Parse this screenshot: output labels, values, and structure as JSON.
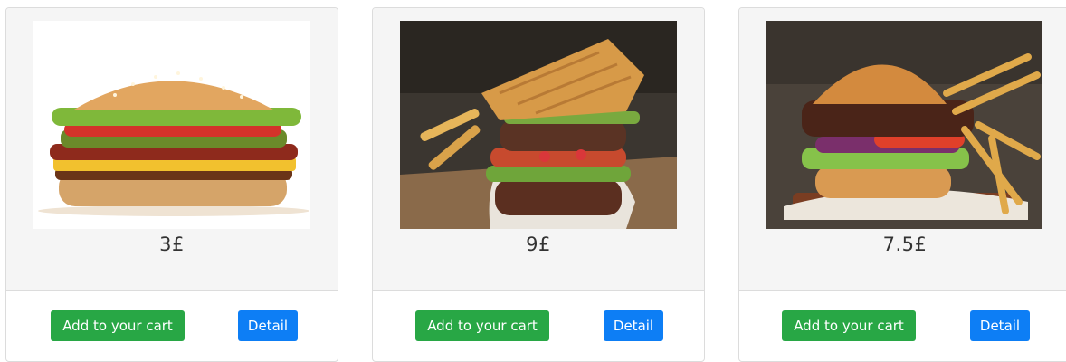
{
  "products": [
    {
      "price": "3£",
      "image_desc": "bacon cheeseburger",
      "cart_label": "Add to your cart",
      "detail_label": "Detail"
    },
    {
      "price": "9£",
      "image_desc": "waffle-bun burger",
      "cart_label": "Add to your cart",
      "detail_label": "Detail"
    },
    {
      "price": "7.5£",
      "image_desc": "burger with fries",
      "cart_label": "Add to your cart",
      "detail_label": "Detail"
    }
  ],
  "colors": {
    "cart_button": "#28a745",
    "detail_button": "#0d7ef5",
    "card_top_bg": "#f5f5f5"
  }
}
